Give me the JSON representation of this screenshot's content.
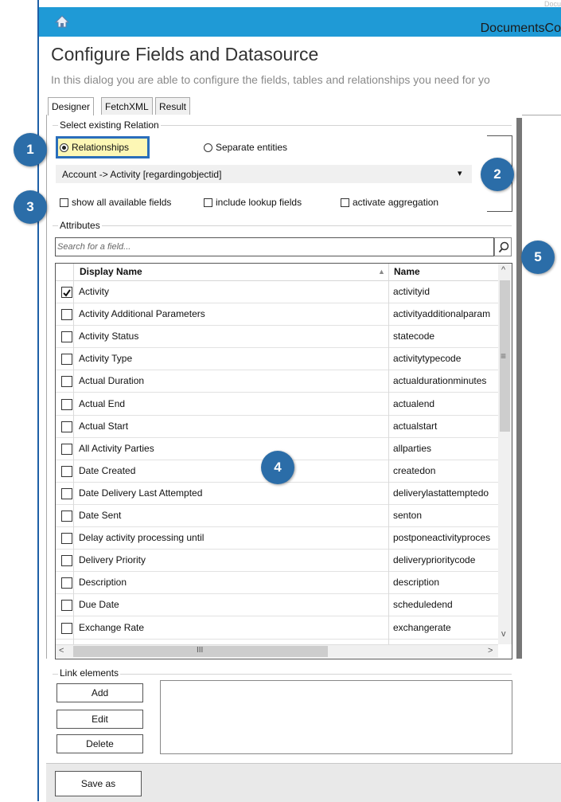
{
  "window": {
    "title": "DocumentsCo",
    "ghost_text": "Docu"
  },
  "dialog": {
    "heading": "Configure Fields and Datasource",
    "description": "In this dialog you are able to configure the fields, tables and relationships you need for yo"
  },
  "tabs": [
    {
      "label": "Designer"
    },
    {
      "label": "FetchXML"
    },
    {
      "label": "Result"
    }
  ],
  "relation": {
    "group_label": "Select existing Relation",
    "option_relationships": "Relationships",
    "option_separate": "Separate entities",
    "selected_option": "Relationships",
    "dropdown_value": "Account -> Activity  [regardingobjectid]",
    "dropdown_arrow": "▾"
  },
  "options": {
    "show_all": "show all available fields",
    "include_lookup": "include lookup fields",
    "activate_aggregation": "activate aggregation"
  },
  "attributes": {
    "group_label": "Attributes",
    "search_placeholder": "Search for a field...",
    "search_icon": "search-icon",
    "columns": {
      "display_name": "Display Name",
      "name": "Name"
    },
    "sort_glyph": "▲",
    "rows": [
      {
        "display": "Activity",
        "name": "activityid",
        "checked": true
      },
      {
        "display": "Activity Additional Parameters",
        "name": "activityadditionalparam",
        "checked": false
      },
      {
        "display": "Activity Status",
        "name": "statecode",
        "checked": false
      },
      {
        "display": "Activity Type",
        "name": "activitytypecode",
        "checked": false
      },
      {
        "display": "Actual Duration",
        "name": "actualdurationminutes",
        "checked": false
      },
      {
        "display": "Actual End",
        "name": "actualend",
        "checked": false
      },
      {
        "display": "Actual Start",
        "name": "actualstart",
        "checked": false
      },
      {
        "display": "All Activity Parties",
        "name": "allparties",
        "checked": false
      },
      {
        "display": "Date Created",
        "name": "createdon",
        "checked": false
      },
      {
        "display": "Date Delivery Last Attempted",
        "name": "deliverylastattemptedo",
        "checked": false
      },
      {
        "display": "Date Sent",
        "name": "senton",
        "checked": false
      },
      {
        "display": "Delay activity processing until",
        "name": "postponeactivityproces",
        "checked": false
      },
      {
        "display": "Delivery Priority",
        "name": "deliveryprioritycode",
        "checked": false
      },
      {
        "display": "Description",
        "name": "description",
        "checked": false
      },
      {
        "display": "Due Date",
        "name": "scheduledend",
        "checked": false
      },
      {
        "display": "Exchange Rate",
        "name": "exchangerate",
        "checked": false
      }
    ],
    "scroll": {
      "up": "^",
      "down": "v",
      "left": "<",
      "right": ">",
      "h_grip": "III",
      "v_grip": "≡"
    }
  },
  "link_elements": {
    "group_label": "Link elements",
    "add": "Add",
    "edit": "Edit",
    "delete": "Delete"
  },
  "footer": {
    "save_as": "Save as"
  },
  "callouts": [
    "1",
    "2",
    "3",
    "4",
    "5"
  ],
  "colors": {
    "titlebar": "#1f9ad6",
    "badge": "#2b6da8",
    "highlight_fill": "#fdf7b5",
    "highlight_border": "#2a6ebb"
  }
}
